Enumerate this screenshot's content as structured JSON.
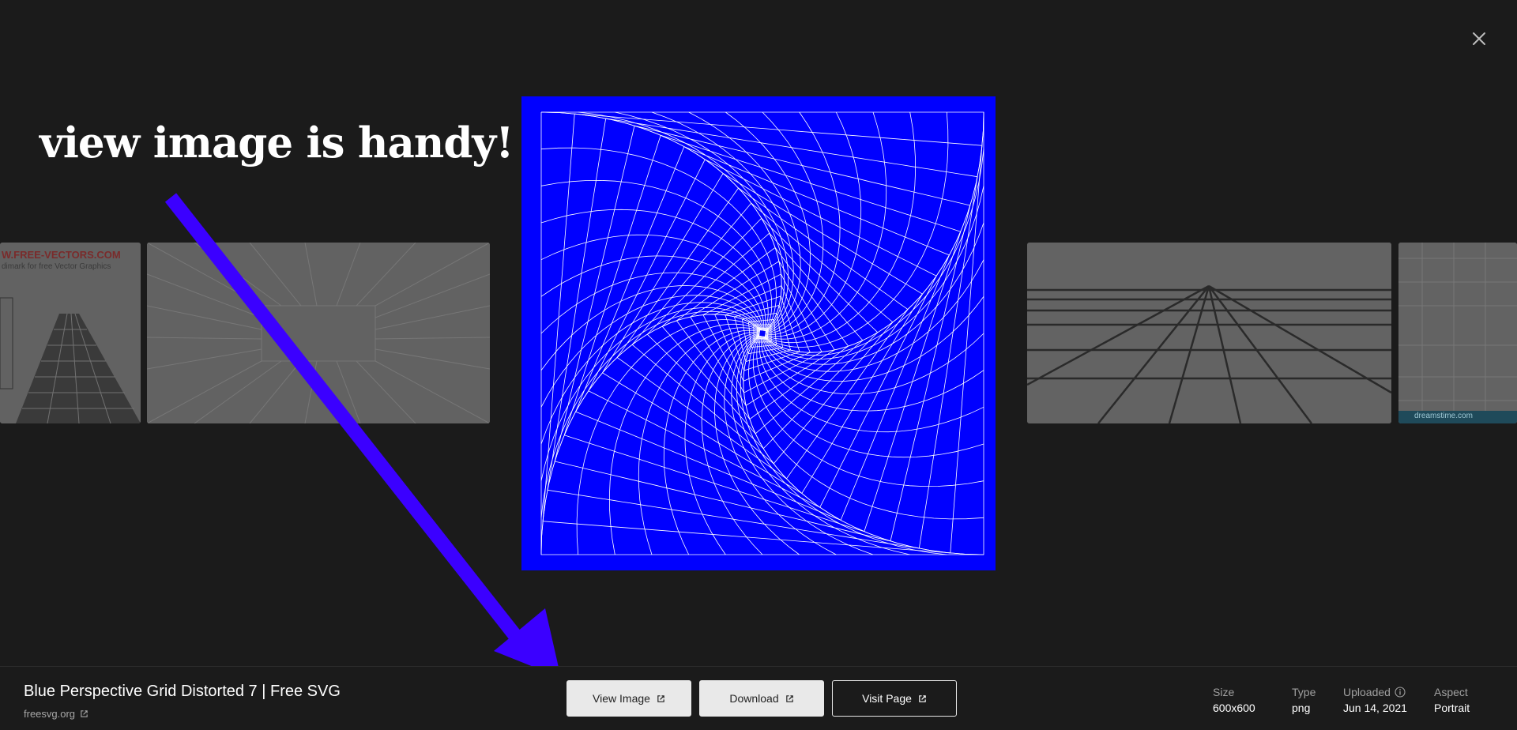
{
  "annotation": {
    "text": "view image is handy!",
    "arrow_color": "#3b00ff"
  },
  "thumbnails": [
    {
      "name": "free-vectors-perspective",
      "watermark": "W.FREE-VECTORS.COM",
      "subtext": "dimark for free Vector Graphics"
    },
    {
      "name": "perspective-room-grid"
    },
    {
      "name": "perspective-floor-grid"
    },
    {
      "name": "partial-grid-dreamstime",
      "watermark": "dreamstime.com"
    }
  ],
  "viewer": {
    "title": "Blue Perspective Grid Distorted 7 | Free SVG",
    "source": "freesvg.org",
    "image_bg": "#0000ff",
    "buttons": {
      "view_image": "View Image",
      "download": "Download",
      "visit_page": "Visit Page"
    },
    "meta": {
      "size_label": "Size",
      "size_value": "600x600",
      "type_label": "Type",
      "type_value": "png",
      "uploaded_label": "Uploaded",
      "uploaded_value": "Jun 14, 2021",
      "aspect_label": "Aspect",
      "aspect_value": "Portrait"
    }
  },
  "icons": {
    "close": "close-icon",
    "external": "external-link-icon",
    "info": "info-icon"
  }
}
